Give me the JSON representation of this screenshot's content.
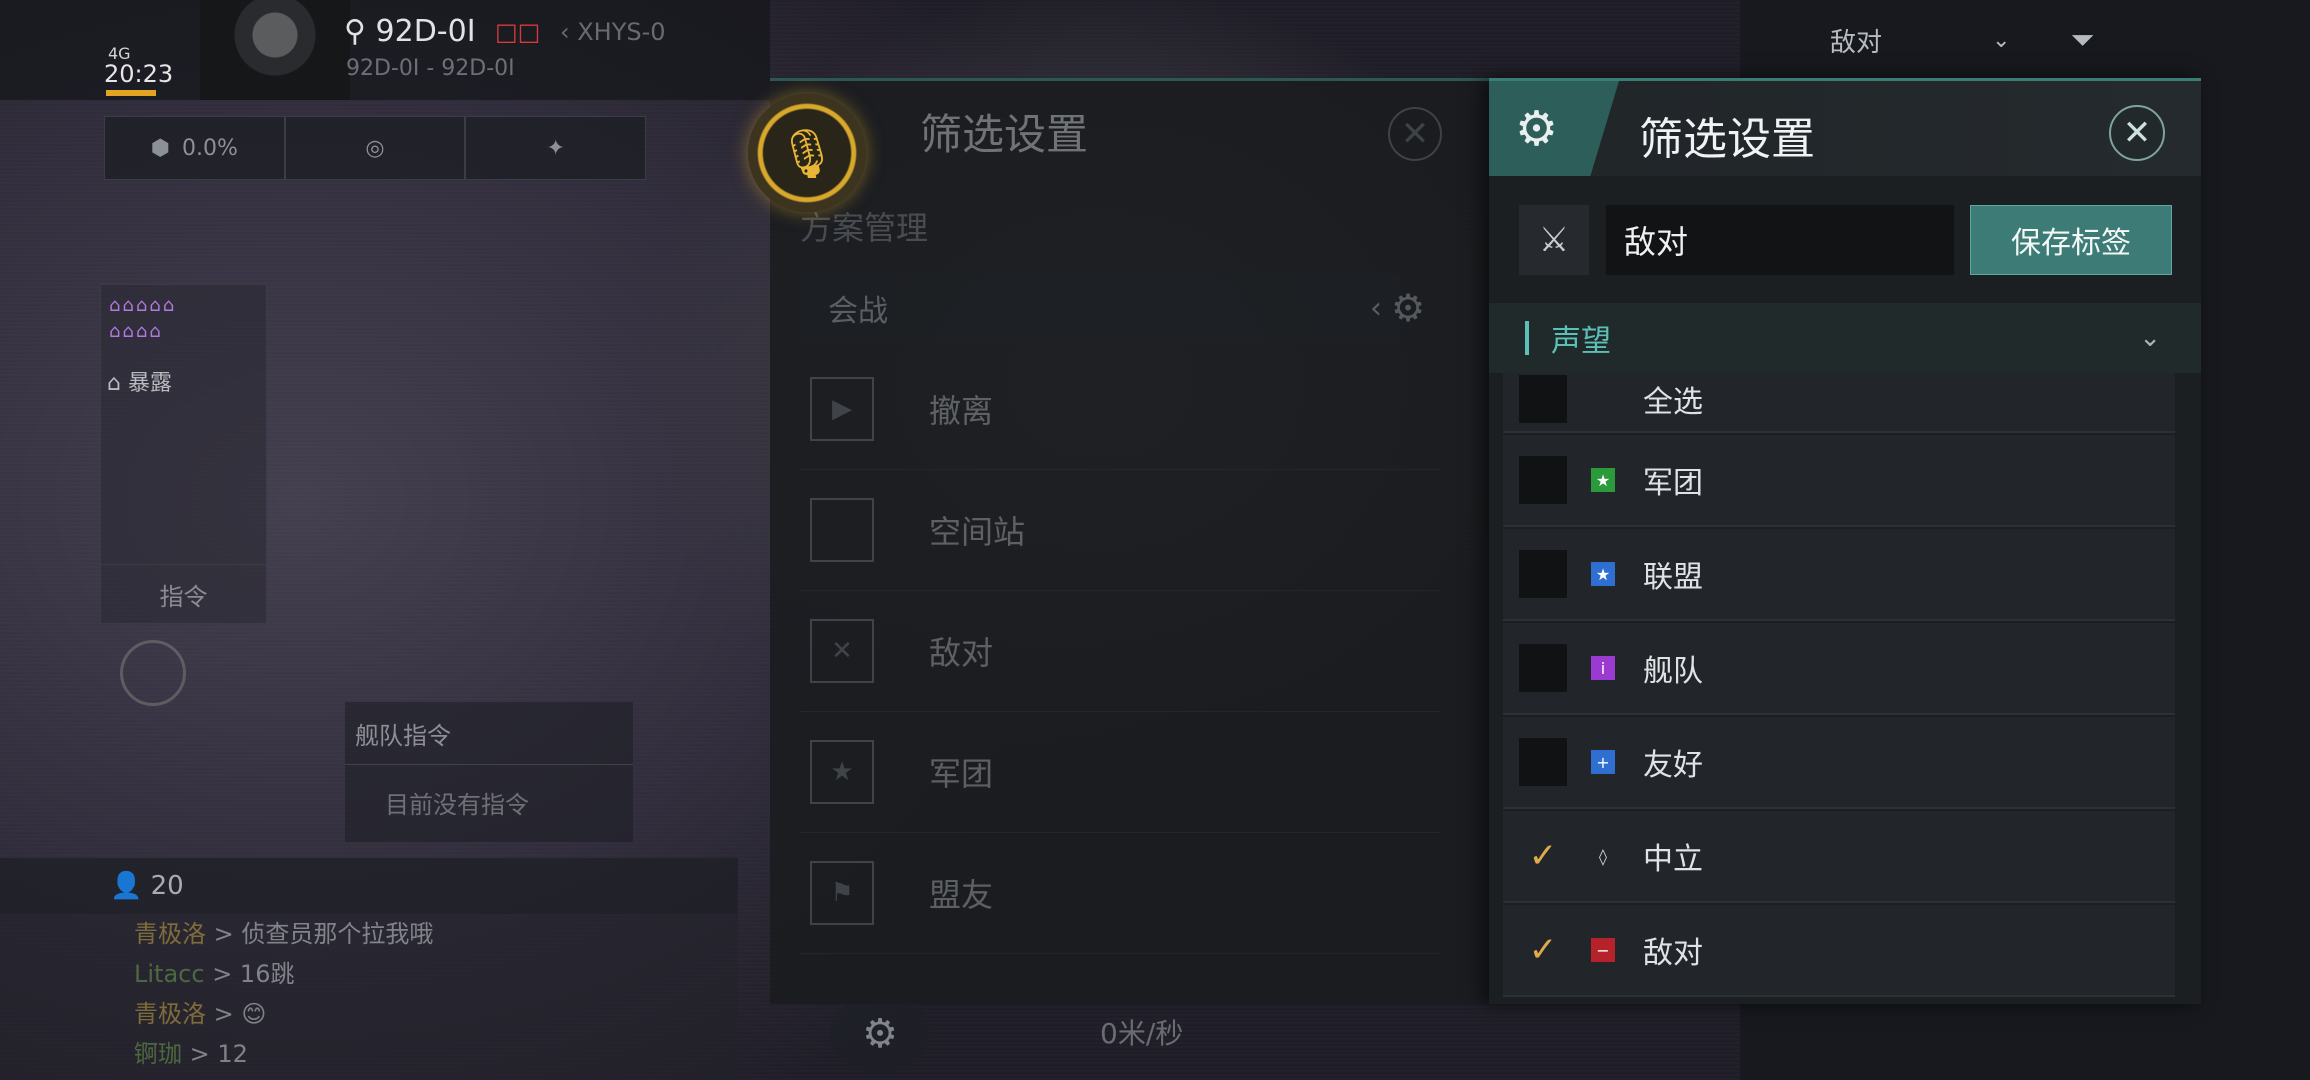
{
  "hud": {
    "network": "4G",
    "time": "20:23",
    "location": "92D-0I",
    "location_tag": "□□",
    "route": "XHYS-0",
    "location_sub": "92D-0I - 92D-0I",
    "stat_value": "0.0%"
  },
  "mini_panel": {
    "exposed_label": "暴露",
    "command_label": "指令"
  },
  "fleet_command": {
    "title": "舰队指令",
    "empty": "目前没有指令"
  },
  "bottom_bar": {
    "people_count": "20"
  },
  "chat": [
    {
      "name": "青极洛",
      "text": "> 侦查员那个拉我哦"
    },
    {
      "name": "Litacc",
      "text": "> 16跳"
    },
    {
      "name": "青极洛",
      "text": "> 😊"
    },
    {
      "name": "锕珈",
      "text": "> 12"
    }
  ],
  "speed": "0米/秒",
  "top_right": {
    "filter_label": "敌对"
  },
  "back_dialog": {
    "title": "筛选设置",
    "section": "方案管理",
    "scheme": "会战",
    "rows": [
      {
        "icon": "evacuate-icon",
        "glyph": "▶",
        "label": "撤离"
      },
      {
        "icon": "station-icon",
        "glyph": "",
        "label": "空间站"
      },
      {
        "icon": "crossed-swords-icon",
        "glyph": "✕",
        "label": "敌对"
      },
      {
        "icon": "legion-icon",
        "glyph": "★",
        "label": "军团"
      },
      {
        "icon": "ally-icon",
        "glyph": "⚑",
        "label": "盟友"
      }
    ]
  },
  "dialog": {
    "title": "筛选设置",
    "tag_value": "敌对",
    "save_label": "保存标签",
    "group_label": "声望",
    "items": [
      {
        "label": "全选",
        "checked": false,
        "badge": "",
        "badge_color": ""
      },
      {
        "label": "军团",
        "checked": false,
        "badge": "★",
        "badge_color": "#2b9a3a"
      },
      {
        "label": "联盟",
        "checked": false,
        "badge": "★",
        "badge_color": "#2e6fd1"
      },
      {
        "label": "舰队",
        "checked": false,
        "badge": "i",
        "badge_color": "#9a3ad0"
      },
      {
        "label": "友好",
        "checked": false,
        "badge": "+",
        "badge_color": "#2e6fd1"
      },
      {
        "label": "中立",
        "checked": true,
        "badge": "◊",
        "badge_color": ""
      },
      {
        "label": "敌对",
        "checked": true,
        "badge": "−",
        "badge_color": "#b5222a"
      }
    ],
    "check_glyph": "✓"
  }
}
